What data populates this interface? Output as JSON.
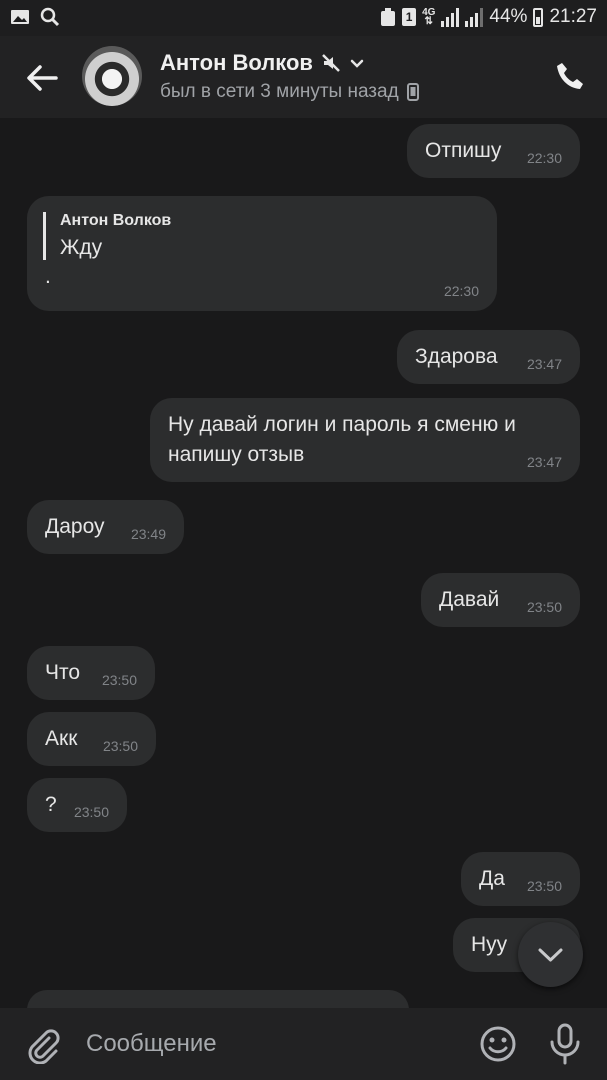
{
  "status_bar": {
    "sim_slot": "1",
    "network": "4G",
    "battery": "44%",
    "time": "21:27"
  },
  "header": {
    "name": "Антон Волков",
    "status": "был в сети 3 минуты назад"
  },
  "messages": [
    {
      "side": "out",
      "text": "Отпишу",
      "time": "22:30"
    },
    {
      "side": "in",
      "quote_name": "Антон Волков",
      "quote_text": "Жду",
      "text": ".",
      "time": "22:30"
    },
    {
      "side": "out",
      "text": "Здарова",
      "time": "23:47"
    },
    {
      "side": "out",
      "text": "Ну давай логин и пароль я сменю и напишу отзыв",
      "time": "23:47"
    },
    {
      "side": "in",
      "text": "Дароу",
      "time": "23:49"
    },
    {
      "side": "out",
      "text": "Давай",
      "time": "23:50"
    },
    {
      "side": "in",
      "text": "Что",
      "time": "23:50"
    },
    {
      "side": "in",
      "text": "Акк",
      "time": "23:50"
    },
    {
      "side": "in",
      "text": "?",
      "time": "23:50"
    },
    {
      "side": "out",
      "text": "Да",
      "time": "23:50"
    },
    {
      "side": "out",
      "text": "Нуу",
      "time": ""
    }
  ],
  "composer": {
    "placeholder": "Сообщение"
  },
  "icons": {
    "gallery": "image-icon",
    "search": "search-icon",
    "back": "arrow-left-icon",
    "mute": "muted-icon",
    "dropdown": "chevron-down-icon",
    "device": "phone-device-icon",
    "call": "phone-icon",
    "scroll_down": "chevron-down-icon",
    "attach": "paperclip-icon",
    "emoji": "smile-icon",
    "voice": "microphone-icon"
  }
}
